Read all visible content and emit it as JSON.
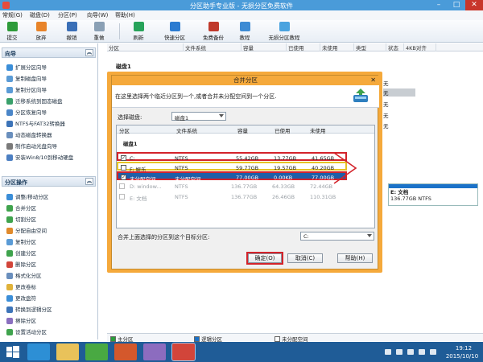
{
  "window": {
    "title": "分区助手专业版 - 无损分区免费软件"
  },
  "menu": [
    "常规(G)",
    "磁盘(D)",
    "分区(P)",
    "向导(W)",
    "帮助(H)"
  ],
  "toolbar": [
    {
      "label": "提交",
      "icon": "commit-icon",
      "color": "#2e9b3a"
    },
    {
      "label": "放弃",
      "icon": "discard-icon",
      "color": "#e8842a"
    },
    {
      "label": "撤销",
      "icon": "undo-icon",
      "color": "#3a6fb7"
    },
    {
      "label": "重做",
      "icon": "redo-icon",
      "color": "#8aa0b5"
    },
    {
      "label": "刷新",
      "icon": "refresh-icon",
      "color": "#27a35a"
    },
    {
      "label": "快速分区",
      "icon": "quick-partition-icon",
      "color": "#2b7bd1"
    },
    {
      "label": "免费备份",
      "icon": "backup-icon",
      "color": "#c0392b"
    },
    {
      "label": "教程",
      "icon": "tutorial-icon",
      "color": "#3d8bd4"
    },
    {
      "label": "无损分区教程",
      "icon": "lossless-tutorial-icon",
      "color": "#4aa3df"
    }
  ],
  "wizard_panel": {
    "title": "向导",
    "items": [
      "扩展分区向导",
      "复制磁盘向导",
      "复制分区向导",
      "迁移系统到固态磁盘",
      "分区恢复向导",
      "NTFS与FAT32转换器",
      "动态磁盘转换器",
      "制作启动光盘向导",
      "安装Win8/10到移动硬盘"
    ]
  },
  "partition_panel": {
    "title": "分区操作",
    "items": [
      "调整/移动分区",
      "合并分区",
      "切割分区",
      "分配自由空间",
      "复制分区",
      "创建分区",
      "删除分区",
      "格式化分区",
      "更改卷标",
      "更改盘符",
      "转换到逻辑分区",
      "擦除分区",
      "设置活动分区"
    ]
  },
  "main": {
    "columns": [
      "分区",
      "文件系统",
      "容量",
      "已使用",
      "未使用",
      "类型",
      "状态",
      "4KB对齐"
    ],
    "disk_label": "磁盘1",
    "side_status": [
      "无",
      "无",
      "无",
      "无",
      "无"
    ],
    "disk_box": {
      "name": "E: 文档",
      "detail": "136.77GB NTFS"
    }
  },
  "legend": [
    {
      "label": "主分区",
      "color": "#2a9d3a"
    },
    {
      "label": "逻辑分区",
      "color": "#1b72c8"
    },
    {
      "label": "未分配空间",
      "color": "#ffffff"
    }
  ],
  "dialog": {
    "title": "合并分区",
    "description": "在这里选择两个临近分区到一个,或者合并未分配空间到一个分区.",
    "select_disk_label": "选择磁盘:",
    "select_disk_value": "磁盘1",
    "table_headers": [
      "分区",
      "文件系统",
      "容量",
      "已使用",
      "未使用"
    ],
    "disk_name": "磁盘1",
    "rows": [
      {
        "checked": "✓",
        "name": "C:",
        "fs": "NTFS",
        "capacity": "55.42GB",
        "used": "13.77GB",
        "free": "41.65GB"
      },
      {
        "checked": "",
        "name": "F: 娱乐",
        "fs": "NTFS",
        "capacity": "59.77GB",
        "used": "19.57GB",
        "free": "40.20GB"
      },
      {
        "checked": "✓",
        "name": "未分配空间",
        "fs": "未分配空间",
        "capacity": "77.00GB",
        "used": "0.00KB",
        "free": "77.00GB"
      },
      {
        "checked": "",
        "name": "D: window...",
        "fs": "NTFS",
        "capacity": "136.77GB",
        "used": "64.33GB",
        "free": "72.44GB"
      },
      {
        "checked": "",
        "name": "E: 文档",
        "fs": "NTFS",
        "capacity": "136.77GB",
        "used": "26.46GB",
        "free": "110.31GB"
      }
    ],
    "target_label": "合并上面选择的分区到这个目标分区:",
    "target_value": "C:",
    "ok": "确定(O)",
    "cancel": "取消(C)",
    "help": "帮助(H)"
  },
  "taskbar": {
    "time": "19:12",
    "date": "2015/10/10",
    "apps": [
      {
        "name": "ie-icon",
        "color": "#2d8fd5"
      },
      {
        "name": "file-explorer-icon",
        "color": "#e9c25a"
      },
      {
        "name": "store-icon",
        "color": "#49a942"
      },
      {
        "name": "media-icon",
        "color": "#d4582c"
      },
      {
        "name": "paint-icon",
        "color": "#8c6cbf"
      },
      {
        "name": "partition-assistant-icon",
        "color": "#d2453a"
      }
    ]
  }
}
